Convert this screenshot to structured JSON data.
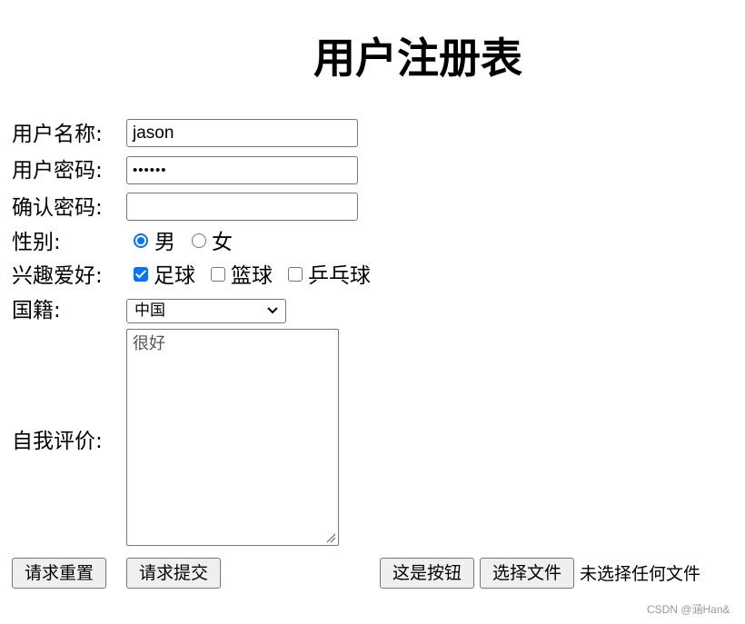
{
  "title": "用户注册表",
  "form": {
    "username": {
      "label": "用户名称:",
      "value": "jason"
    },
    "password": {
      "label": "用户密码:",
      "value": "••••••"
    },
    "confirm_password": {
      "label": "确认密码:",
      "value": ""
    },
    "gender": {
      "label": "性别:",
      "options": [
        {
          "label": "男",
          "checked": true
        },
        {
          "label": "女",
          "checked": false
        }
      ]
    },
    "hobbies": {
      "label": "兴趣爱好:",
      "options": [
        {
          "label": "足球",
          "checked": true
        },
        {
          "label": "篮球",
          "checked": false
        },
        {
          "label": "乒乓球",
          "checked": false
        }
      ]
    },
    "nationality": {
      "label": "国籍:",
      "selected": "中国"
    },
    "self_evaluation": {
      "label": "自我评价:",
      "placeholder": "很好"
    }
  },
  "buttons": {
    "reset": "请求重置",
    "submit": "请求提交",
    "plain": "这是按钮",
    "choose_file": "选择文件",
    "no_file": "未选择任何文件"
  },
  "watermark": "CSDN @涵Han&",
  "colors": {
    "accent": "#0075ff",
    "border": "#767676",
    "button_bg": "#efefef"
  }
}
